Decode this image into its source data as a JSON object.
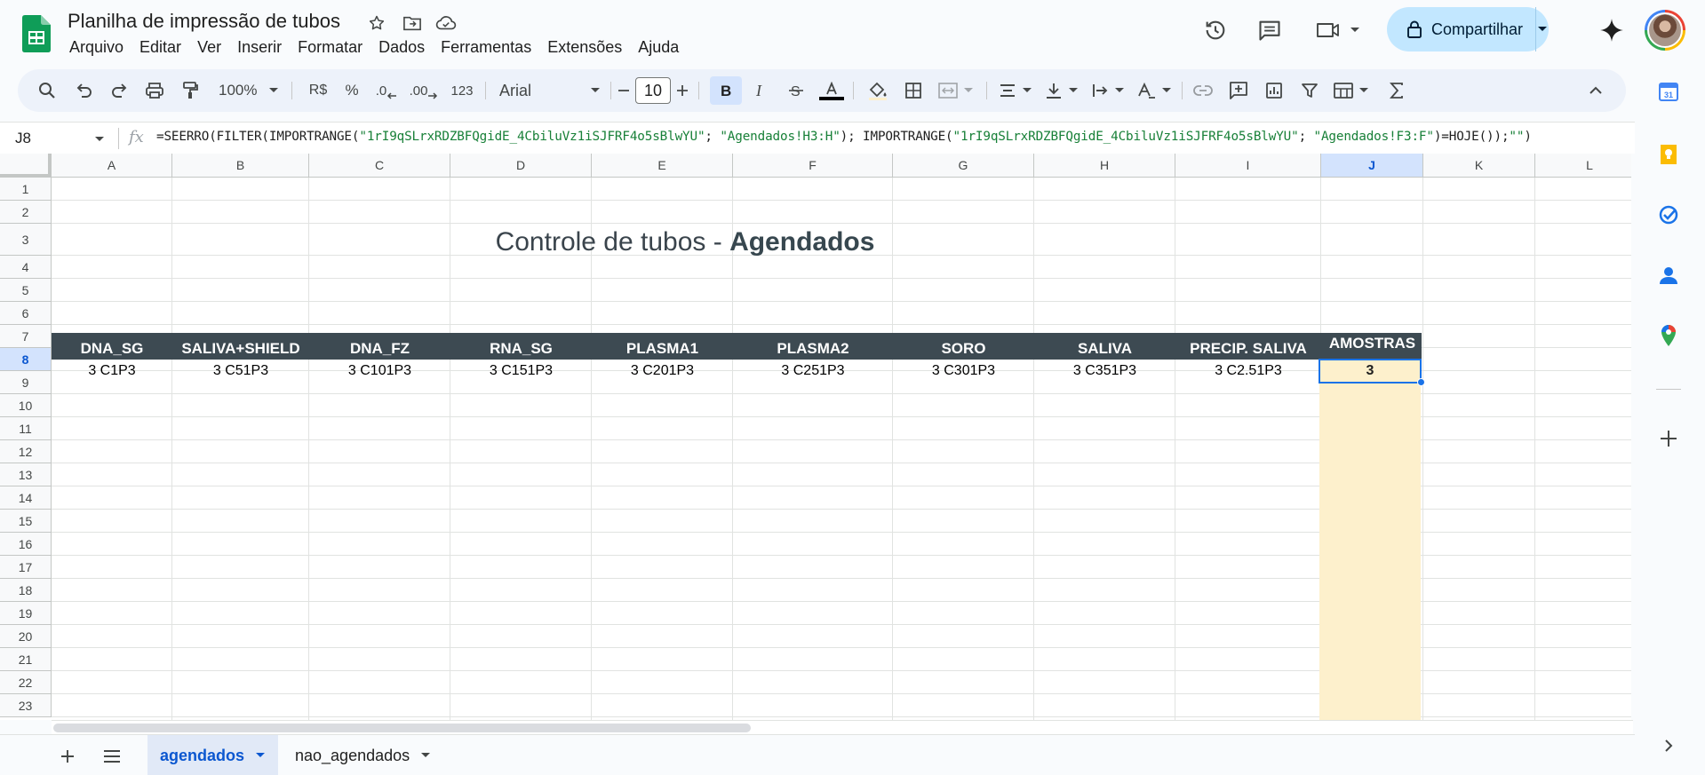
{
  "header": {
    "title": "Planilha de impressão de tubos",
    "menu": [
      "Arquivo",
      "Editar",
      "Ver",
      "Inserir",
      "Formatar",
      "Dados",
      "Ferramentas",
      "Extensões",
      "Ajuda"
    ],
    "share_label": "Compartilhar"
  },
  "toolbar": {
    "zoom": "100%",
    "currency": "R$",
    "percent": "%",
    "dec_decrease": ".0",
    "dec_increase": ".00",
    "number_format": "123",
    "font": "Arial",
    "font_size": "10"
  },
  "formula_bar": {
    "cell_ref": "J8",
    "parts": [
      {
        "text": "=SEERRO(FILTER(IMPORTRANGE(",
        "type": "code"
      },
      {
        "text": "\"1rI9qSLrxRDZBFQgidE_4CbiluVz1iSJFRF4o5sBlwYU\"",
        "type": "string"
      },
      {
        "text": "; ",
        "type": "code"
      },
      {
        "text": "\"Agendados!H3:H\"",
        "type": "string"
      },
      {
        "text": "); IMPORTRANGE(",
        "type": "code"
      },
      {
        "text": "\"1rI9qSLrxRDZBFQgidE_4CbiluVz1iSJFRF4o5sBlwYU\"",
        "type": "string"
      },
      {
        "text": "; ",
        "type": "code"
      },
      {
        "text": "\"Agendados!F3:F\"",
        "type": "string"
      },
      {
        "text": ")=HOJE());",
        "type": "code"
      },
      {
        "text": "\"\"",
        "type": "string"
      },
      {
        "text": ")",
        "type": "code"
      }
    ]
  },
  "grid": {
    "columns": [
      "A",
      "B",
      "C",
      "D",
      "E",
      "F",
      "G",
      "H",
      "I",
      "J",
      "K",
      "L"
    ],
    "rows": [
      "1",
      "2",
      "3",
      "4",
      "5",
      "6",
      "7",
      "8",
      "9",
      "10",
      "11",
      "12",
      "13",
      "14",
      "15",
      "16",
      "17",
      "18",
      "19",
      "20",
      "21",
      "22",
      "23"
    ],
    "selected_col": "J",
    "selected_row": "8",
    "title_plain": "Controle de tubos - ",
    "title_bold": "Agendados",
    "headers": [
      "DNA_SG",
      "SALIVA+SHIELD",
      "DNA_FZ",
      "RNA_SG",
      "PLASMA1",
      "PLASMA2",
      "SORO",
      "SALIVA",
      "PRECIP. SALIVA",
      "AMOSTRAS"
    ],
    "row8": [
      "3 C1P3",
      "3 C51P3",
      "3 C101P3",
      "3 C151P3",
      "3 C201P3",
      "3 C251P3",
      "3 C301P3",
      "3 C351P3",
      "3 C2.51P3",
      "3"
    ]
  },
  "sheets": {
    "tabs": [
      "agendados",
      "nao_agendados"
    ],
    "active": "agendados"
  },
  "colors": {
    "header_band": "#3d4a52",
    "highlight_column": "#fdf0cc",
    "selection": "#1a73e8",
    "share_button": "#c2e7ff"
  }
}
